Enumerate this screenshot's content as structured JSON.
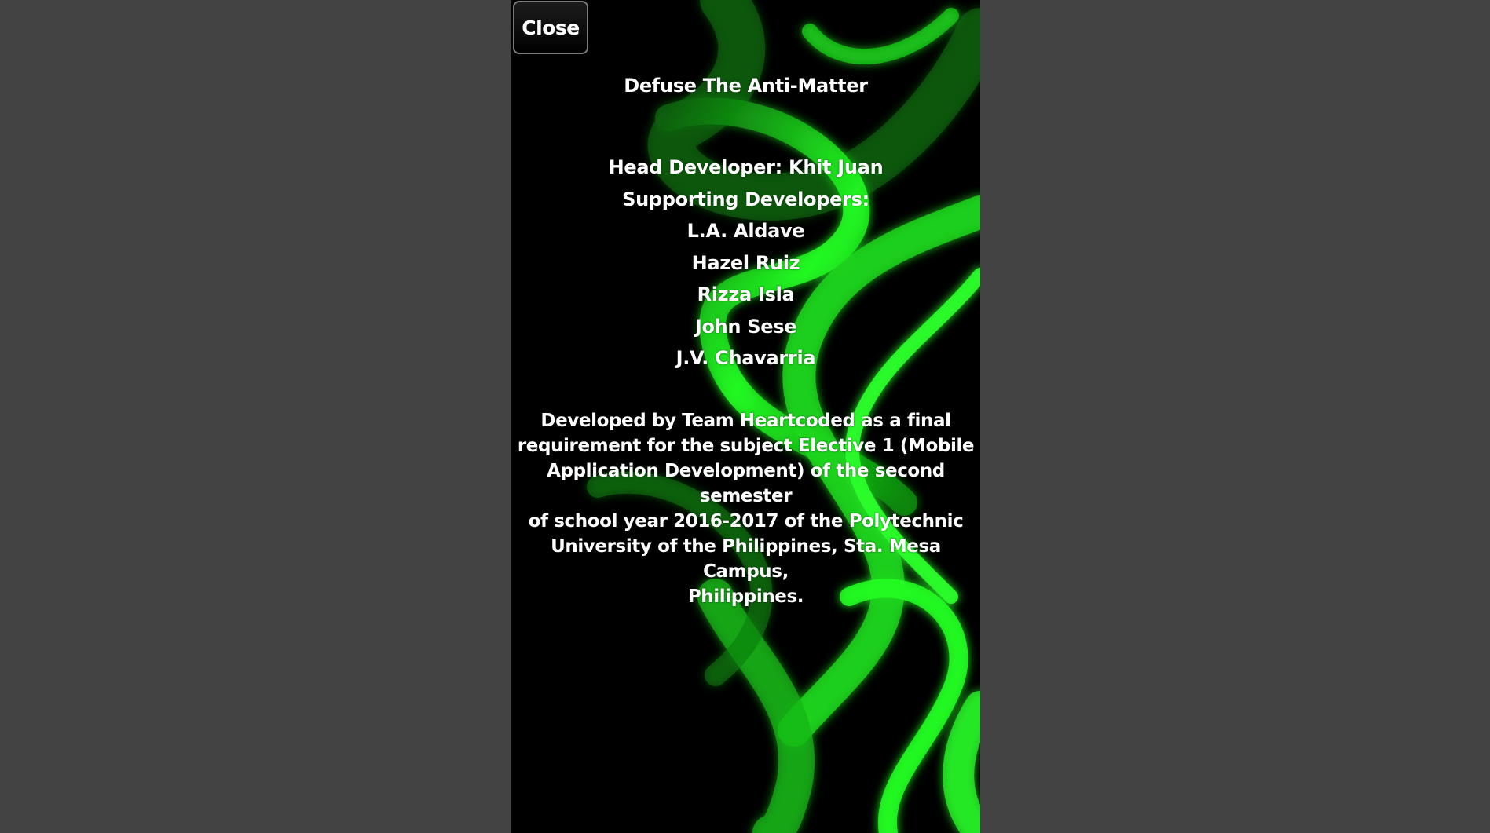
{
  "dialog": {
    "close_label": "Close",
    "title": "Defuse The Anti-Matter",
    "head_developer": "Head Developer: Khit Juan",
    "supporting_label": "Supporting Developers:",
    "supporting_developers": [
      "L.A. Aldave",
      "Hazel Ruiz",
      "Rizza Isla",
      "John Sese",
      "J.V. Chavarria"
    ],
    "blurb_lines": [
      "Developed by Team Heartcoded as a final",
      "requirement for the subject Elective 1 (Mobile",
      "Application Development) of the second semester",
      "of school year 2016-2017 of the Polytechnic",
      "University of the Philippines, Sta. Mesa Campus,",
      "Philippines."
    ]
  },
  "colors": {
    "outer_background": "#434343",
    "phone_background": "#000000",
    "accent_green": "#22ff22",
    "text": "#ffffff"
  }
}
